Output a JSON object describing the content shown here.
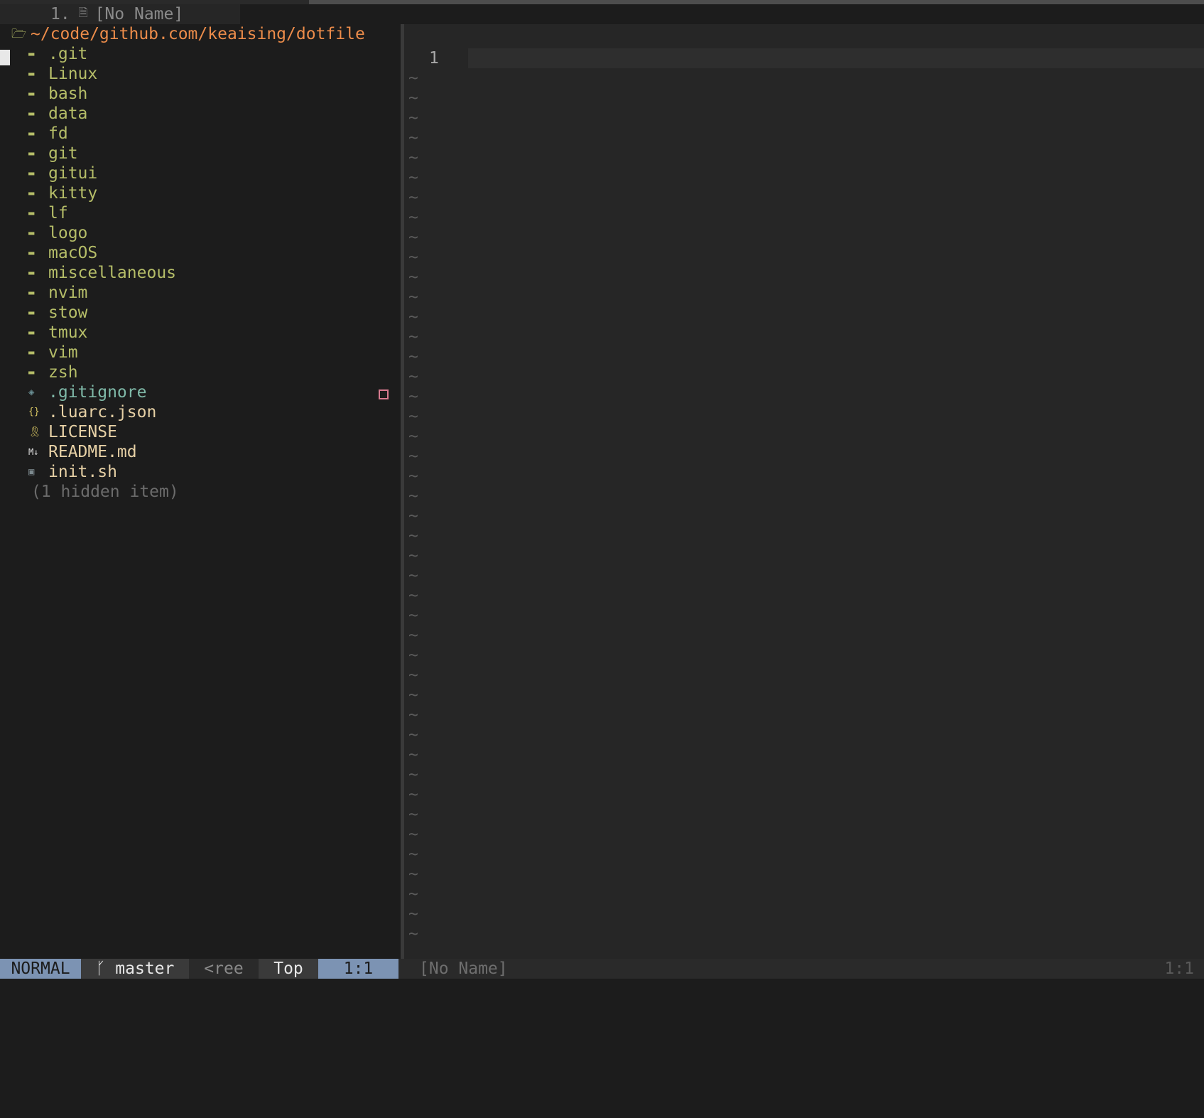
{
  "tabline": {
    "tab_number": "1.",
    "tab_icon": "file-icon",
    "tab_name": "[No Name]"
  },
  "tree": {
    "root_icon": "folder-open-icon",
    "root_path": "~/code/github.com/keaising/dotfile",
    "directories": [
      ".git",
      "Linux",
      "bash",
      "data",
      "fd",
      "git",
      "gitui",
      "kitty",
      "lf",
      "logo",
      "macOS",
      "miscellaneous",
      "nvim",
      "stow",
      "tmux",
      "vim",
      "zsh"
    ],
    "files": [
      {
        "name": ".gitignore",
        "icon": "git-icon",
        "kind": "git"
      },
      {
        "name": ".luarc.json",
        "icon": "json-icon",
        "kind": "json"
      },
      {
        "name": "LICENSE",
        "icon": "license-icon",
        "kind": "lic"
      },
      {
        "name": "README.md",
        "icon": "markdown-icon",
        "kind": "md"
      },
      {
        "name": "init.sh",
        "icon": "terminal-icon",
        "kind": "sh"
      }
    ],
    "hidden_note": "(1 hidden item)"
  },
  "editor": {
    "line_number": "1",
    "tilde": "~"
  },
  "statusline": {
    "mode": "NORMAL",
    "branch_icon": "git-branch-icon",
    "branch": "master",
    "filename_trunc": "<ree",
    "scroll": "Top",
    "position": "1:1",
    "inactive_name": "[No Name]",
    "inactive_position": "1:1"
  },
  "colors": {
    "directory": "#b5bd68",
    "root_path": "#ec8c4a",
    "mode_bg": "#7c93b3",
    "git_marker": "#d77a8f"
  }
}
